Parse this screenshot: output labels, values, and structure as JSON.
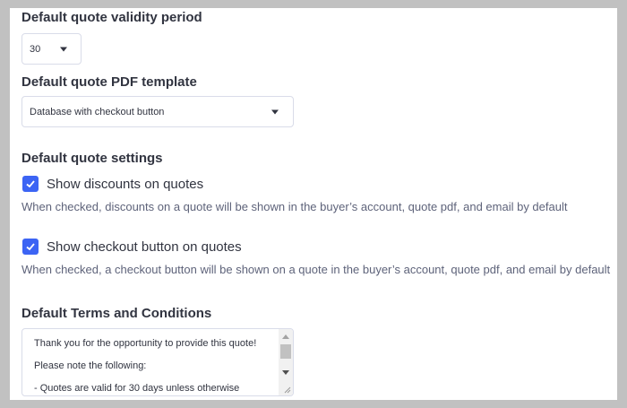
{
  "validity": {
    "label": "Default quote validity period",
    "value": "30"
  },
  "pdf_template": {
    "label": "Default quote PDF template",
    "value": "Database with checkout button"
  },
  "settings": {
    "label": "Default quote settings",
    "items": [
      {
        "label": "Show discounts on quotes",
        "checked": true,
        "help": "When checked, discounts on a quote will be shown in the buyer’s account, quote pdf, and email by default"
      },
      {
        "label": "Show checkout button on quotes",
        "checked": true,
        "help": "When checked, a checkout button will be shown on a quote in the buyer’s account, quote pdf, and email by default"
      }
    ]
  },
  "terms": {
    "label": "Default Terms and Conditions",
    "lines": [
      "Thank you for the opportunity to provide this quote!",
      "Please note the following:",
      " - Quotes are valid for 30 days unless otherwise"
    ]
  },
  "colors": {
    "accent": "#3c64f4",
    "background": "#c1c1c1"
  }
}
